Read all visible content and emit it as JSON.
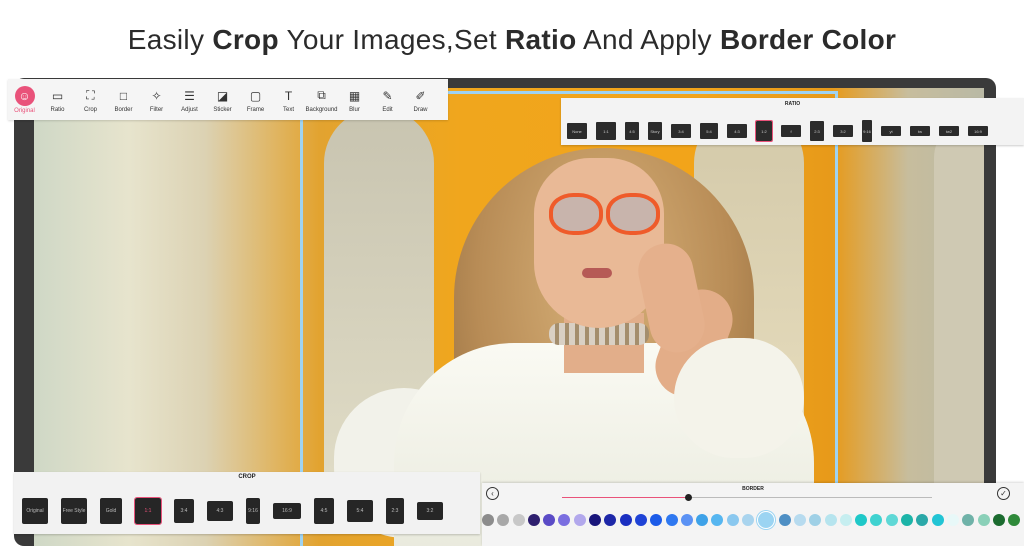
{
  "headline": {
    "part1": "Easily ",
    "part2": "Crop",
    "part3": " Your Images,Set ",
    "part4": "Ratio",
    "part5": " And Apply ",
    "part6": "Border Color"
  },
  "toolbar": {
    "items": [
      {
        "label": "Original",
        "icon": "original-icon",
        "active": true
      },
      {
        "label": "Ratio",
        "icon": "ratio-icon"
      },
      {
        "label": "Crop",
        "icon": "crop-icon"
      },
      {
        "label": "Border",
        "icon": "border-icon"
      },
      {
        "label": "Filter",
        "icon": "filter-icon"
      },
      {
        "label": "Adjust",
        "icon": "adjust-icon"
      },
      {
        "label": "Sticker",
        "icon": "sticker-icon"
      },
      {
        "label": "Frame",
        "icon": "frame-icon"
      },
      {
        "label": "Text",
        "icon": "text-icon"
      },
      {
        "label": "Background",
        "icon": "background-icon"
      },
      {
        "label": "Blur",
        "icon": "blur-icon"
      },
      {
        "label": "Edit",
        "icon": "edit-icon"
      },
      {
        "label": "Draw",
        "icon": "draw-icon"
      }
    ],
    "accent": "#e9527a"
  },
  "ratio_panel": {
    "title": "RATIO",
    "items": [
      "None",
      "1:1",
      "4:5",
      "Story",
      "3:4",
      "5:4",
      "4:3",
      "1:2",
      "f",
      "2:3",
      "3:2",
      "9:16",
      "yt",
      "tw",
      "tw2",
      "16:9"
    ]
  },
  "crop_panel": {
    "title": "CROP",
    "items": [
      "Original",
      "Free Style",
      "Gold",
      "1:1",
      "3:4",
      "4:3",
      "9:16",
      "16:9",
      "4:5",
      "5:4",
      "2:3",
      "3:2"
    ],
    "selected": "1:1"
  },
  "border_panel": {
    "title": "BORDER",
    "slider_value": 0.34,
    "swatches": [
      "#8c8c8c",
      "#a8a8a8",
      "#c8c8c8",
      "#2e1f6e",
      "#5a4bc6",
      "#7a6ee0",
      "#b2a8ec",
      "#18157a",
      "#1d27a8",
      "#1a2fc0",
      "#1f43d6",
      "#1c5be8",
      "#2f78f0",
      "#5b92f4",
      "#3ea2e8",
      "#56b6f0",
      "#8ac8ef",
      "#a9d4ee",
      "#9bd4f2",
      "#4e8fc4",
      "#b7dbef",
      "#9fd0e6",
      "#b6e4ee",
      "#c6eef0",
      "#1fc8c8",
      "#3fd2d0",
      "#5fd8d6",
      "#1cb4a8",
      "#2aa8a8",
      "#22c4d4",
      "#e8f8f8",
      "#6fb2a8",
      "#8ad0b8",
      "#1b6b2f",
      "#2f8a3a"
    ],
    "selected_index": 18
  }
}
